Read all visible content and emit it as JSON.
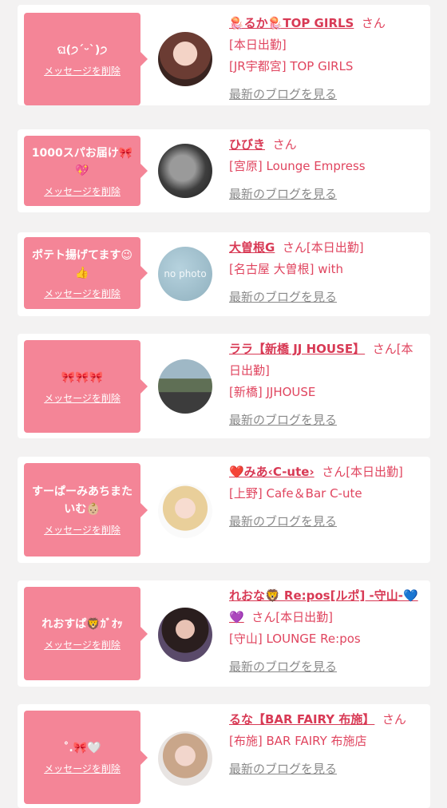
{
  "cards": [
    {
      "message": "ଘ(੭ˊᵕˋ)੭",
      "delete_label": "メッセージを削除",
      "name": "🪼るか🪼TOP GIRLS",
      "suffix": "さん",
      "line2": "[本日出勤]",
      "shop": "[JR宇都宮] TOP GIRLS",
      "blog": "最新のブログを見る"
    },
    {
      "message": "1000スパお届け🎀💖",
      "delete_label": "メッセージを削除",
      "name": "ひびき",
      "suffix": "さん",
      "shop": "[宮原] Lounge Empress",
      "blog": "最新のブログを見る"
    },
    {
      "message": "ポテト揚げてます😉👍",
      "delete_label": "メッセージを削除",
      "name": "大曽根G",
      "suffix": "さん[本日出勤]",
      "shop": "[名古屋 大曽根] with",
      "blog": "最新のブログを見る",
      "avatar_text": "no photo"
    },
    {
      "message": "🎀🎀🎀",
      "delete_label": "メッセージを削除",
      "name": "ララ【新橋 JJ HOUSE】",
      "suffix": "さん[本日出勤]",
      "shop": "[新橋] JJHOUSE",
      "blog": "最新のブログを見る"
    },
    {
      "message": "すーぱーみあちまたいむ👶🏼",
      "delete_label": "メッセージを削除",
      "name": "❤️みあ‹C-ute›",
      "suffix": "さん[本日出勤]",
      "shop": "[上野] Cafe＆Bar C-ute",
      "blog": "最新のブログを見る"
    },
    {
      "message": "れおすぱ🦁ｶﾞｵｯ",
      "delete_label": "メッセージを削除",
      "name": "れおな🦁 Re:pos[ルポ] -守山-💙💜",
      "suffix": "さん[本日出勤]",
      "shop": "[守山] LOUNGE Re:pos",
      "blog": "最新のブログを見る"
    },
    {
      "message": "˚.🎀🤍",
      "delete_label": "メッセージを削除",
      "name": "るな【BAR FAIRY 布施】",
      "suffix": "さん",
      "shop": "[布施] BAR FAIRY 布施店",
      "blog": "最新のブログを見る"
    }
  ]
}
